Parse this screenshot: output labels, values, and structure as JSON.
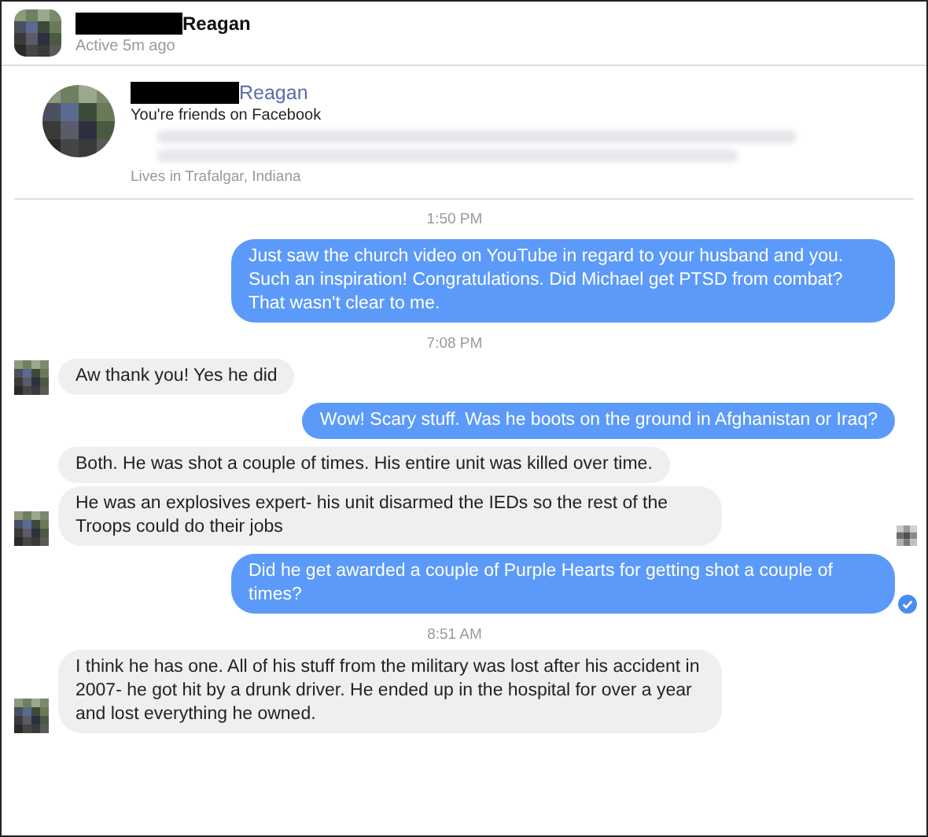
{
  "header": {
    "name": "Reagan",
    "status": "Active 5m ago"
  },
  "profile": {
    "name": "Reagan",
    "relation": "You're friends on Facebook",
    "location": "Lives in Trafalgar, Indiana"
  },
  "messages": [
    {
      "kind": "time",
      "text": "1:50 PM"
    },
    {
      "kind": "out",
      "text": "Just saw the church video on YouTube in regard to your husband and you. Such an inspiration!  Congratulations.  Did Michael get PTSD from combat?  That wasn't clear to me.",
      "delivered": false
    },
    {
      "kind": "time",
      "text": "7:08 PM"
    },
    {
      "kind": "in",
      "text": "Aw thank you! Yes he did",
      "avatar": true,
      "seen": false
    },
    {
      "kind": "out",
      "text": "Wow!  Scary stuff.  Was he boots on the ground in Afghanistan or Iraq?",
      "delivered": false
    },
    {
      "kind": "in",
      "text": "Both. He was shot a couple of times. His entire unit was killed over time.",
      "avatar": false,
      "seen": false
    },
    {
      "kind": "in",
      "text": "He was an explosives expert- his unit disarmed the IEDs so the rest of the Troops could do their jobs",
      "avatar": true,
      "seen": true
    },
    {
      "kind": "out",
      "text": "Did he get awarded a couple of Purple Hearts for getting shot a couple of times?",
      "delivered": true
    },
    {
      "kind": "time",
      "text": "8:51 AM"
    },
    {
      "kind": "in",
      "text": "I think he has one. All of his stuff from the military was lost after his accident in 2007- he got hit by a drunk driver. He ended up in the hospital for over a year and lost everything he owned.",
      "avatar": true,
      "seen": false
    }
  ]
}
